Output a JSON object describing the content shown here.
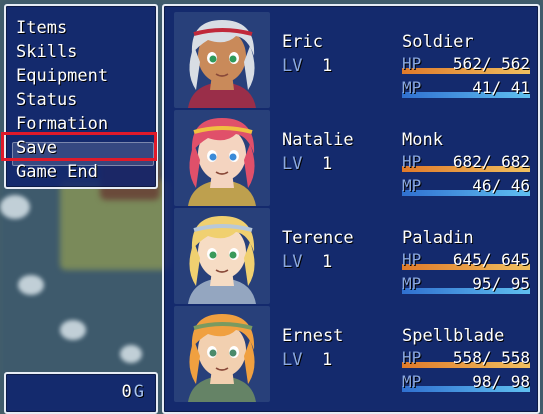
{
  "menu": {
    "items": [
      "Items",
      "Skills",
      "Equipment",
      "Status",
      "Formation",
      "Save",
      "Game End"
    ],
    "selected": "Save",
    "highlight_color": "#e01a2a"
  },
  "gold": {
    "amount": "0",
    "unit": "G"
  },
  "labels": {
    "lv": "LV",
    "hp": "HP",
    "mp": "MP"
  },
  "party": [
    {
      "name": "Eric",
      "level": "1",
      "class": "Soldier",
      "hp": "562",
      "mhp": "562",
      "mp": "41",
      "mmp": "41",
      "hp_ratio": 1.0,
      "mp_ratio": 1.0,
      "hair": "#d8dde4",
      "skin": "#c98a5a",
      "eye": "#2f9a5a",
      "accent": "#c0283a"
    },
    {
      "name": "Natalie",
      "level": "1",
      "class": "Monk",
      "hp": "682",
      "mhp": "682",
      "mp": "46",
      "mmp": "46",
      "hp_ratio": 1.0,
      "mp_ratio": 1.0,
      "hair": "#e0506a",
      "skin": "#f4d4c0",
      "eye": "#3a8ad8",
      "accent": "#f0c040"
    },
    {
      "name": "Terence",
      "level": "1",
      "class": "Paladin",
      "hp": "645",
      "mhp": "645",
      "mp": "95",
      "mmp": "95",
      "hp_ratio": 1.0,
      "mp_ratio": 1.0,
      "hair": "#f0d070",
      "skin": "#f6dcc4",
      "eye": "#3a9a5a",
      "accent": "#b8c8d8"
    },
    {
      "name": "Ernest",
      "level": "1",
      "class": "Spellblade",
      "hp": "558",
      "mhp": "558",
      "mp": "98",
      "mmp": "98",
      "hp_ratio": 1.0,
      "mp_ratio": 1.0,
      "hair": "#f0a040",
      "skin": "#f2d0b0",
      "eye": "#4a8a6a",
      "accent": "#7a9a60"
    }
  ]
}
